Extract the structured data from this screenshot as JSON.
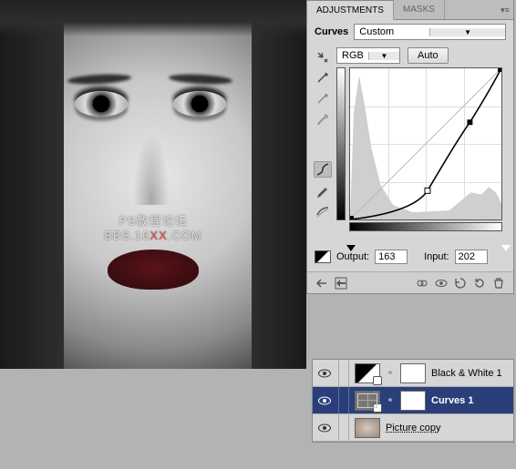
{
  "watermark": {
    "line1": "PS教程论坛",
    "line2_pre": "BBS.16",
    "line2_mid": "XX",
    "line2_post": ".COM"
  },
  "panel": {
    "tabs": {
      "adjustments": "ADJUSTMENTS",
      "masks": "MASKS"
    },
    "title": "Curves",
    "preset": "Custom",
    "channel": "RGB",
    "auto": "Auto",
    "output_label": "Output:",
    "output_value": "163",
    "input_label": "Input:",
    "input_value": "202"
  },
  "layers": [
    {
      "name": "Black & White 1",
      "type": "bw"
    },
    {
      "name": "Curves 1",
      "type": "curves"
    },
    {
      "name": "Picture copy",
      "type": "image"
    }
  ],
  "chart_data": {
    "type": "line",
    "title": "Curves",
    "xlabel": "Input",
    "ylabel": "Output",
    "xlim": [
      0,
      255
    ],
    "ylim": [
      0,
      255
    ],
    "series": [
      {
        "name": "baseline",
        "x": [
          0,
          255
        ],
        "y": [
          0,
          255
        ]
      },
      {
        "name": "curve",
        "points": [
          {
            "x": 0,
            "y": 0
          },
          {
            "x": 130,
            "y": 48
          },
          {
            "x": 202,
            "y": 163
          },
          {
            "x": 255,
            "y": 255
          }
        ]
      }
    ],
    "histogram_peaks": [
      {
        "x": 15,
        "h": 0.95
      },
      {
        "x": 40,
        "h": 0.45
      },
      {
        "x": 200,
        "h": 0.18
      },
      {
        "x": 235,
        "h": 0.22
      }
    ]
  }
}
